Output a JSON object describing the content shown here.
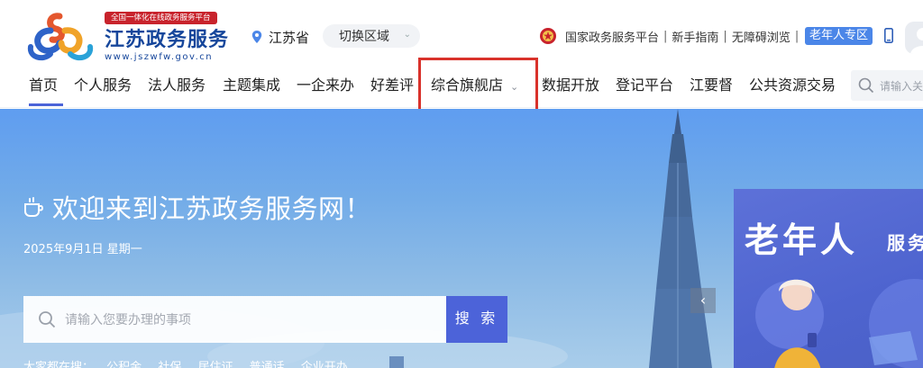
{
  "header": {
    "slogan": "全国一体化在线政务服务平台",
    "site_title": "江苏政务服务",
    "site_url": "www.jszwfw.gov.cn",
    "region": {
      "current": "江苏省",
      "switch_label": "切换区域"
    },
    "links": [
      "国家政务服务平台",
      "新手指南",
      "无障碍浏览"
    ],
    "elder_badge": "老年人专区"
  },
  "nav": {
    "items": [
      "首页",
      "个人服务",
      "法人服务",
      "主题集成",
      "一企来办",
      "好差评",
      "综合旗舰店",
      "数据开放",
      "登记平台",
      "江要督",
      "公共资源交易"
    ],
    "active_index": 0,
    "search_placeholder": "请输入关"
  },
  "hero": {
    "welcome": "欢迎来到江苏政务服务网！",
    "date": "2025年9月1日 星期一",
    "search_placeholder": "请输入您要办理的事项",
    "search_button": "搜 索",
    "hot_label": "大家都在搜：",
    "hot_items": [
      "公积金",
      "社保",
      "居住证",
      "普通话",
      "企业开办"
    ],
    "elder_panel": {
      "title": "老年人",
      "subtitle": "服务"
    }
  },
  "colors": {
    "brand_blue": "#16469b",
    "accent": "#4c63d9",
    "slogan_red": "#c8232c",
    "highlight_red": "#d9322b"
  }
}
